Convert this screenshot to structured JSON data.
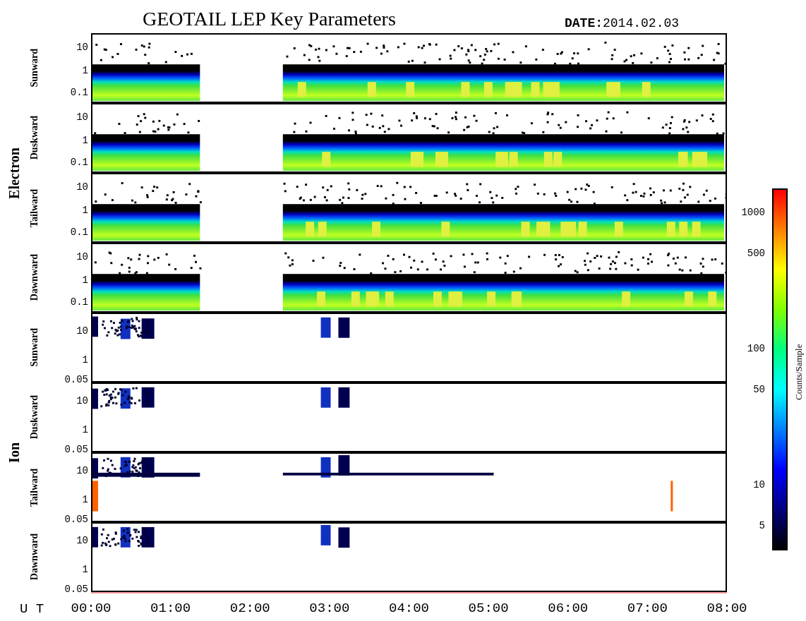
{
  "title": "GEOTAIL LEP Key Parameters",
  "date": "**DATE:**2014.02.03",
  "groups": [
    {
      "label": "Electron",
      "kind": "electron",
      "panels": [
        {
          "label": "Sunward",
          "yticks": [
            "10",
            "1",
            "0.1"
          ]
        },
        {
          "label": "Duskward",
          "yticks": [
            "10",
            "1",
            "0.1"
          ]
        },
        {
          "label": "Tailward",
          "yticks": [
            "10",
            "1",
            "0.1"
          ]
        },
        {
          "label": "Dawnward",
          "yticks": [
            "10",
            "1",
            "0.1"
          ]
        }
      ]
    },
    {
      "label": "Ion",
      "kind": "ion",
      "panels": [
        {
          "label": "Sunward",
          "yticks": [
            "10",
            "1",
            "0.05"
          ]
        },
        {
          "label": "Duskward",
          "yticks": [
            "10",
            "1",
            "0.05"
          ]
        },
        {
          "label": "Tailward",
          "yticks": [
            "10",
            "1",
            "0.05"
          ]
        },
        {
          "label": "Dawnward",
          "yticks": [
            "10",
            "1",
            "0.05"
          ]
        }
      ]
    }
  ],
  "colorbar": {
    "label": "Counts/Sample",
    "ticks": [
      "1000",
      "500",
      "100",
      "50",
      "10",
      "5"
    ]
  },
  "time_axis": {
    "label": "U T",
    "ticks": [
      "00:00",
      "01:00",
      "02:00",
      "03:00",
      "04:00",
      "05:00",
      "06:00",
      "07:00",
      "08:00"
    ]
  }
}
